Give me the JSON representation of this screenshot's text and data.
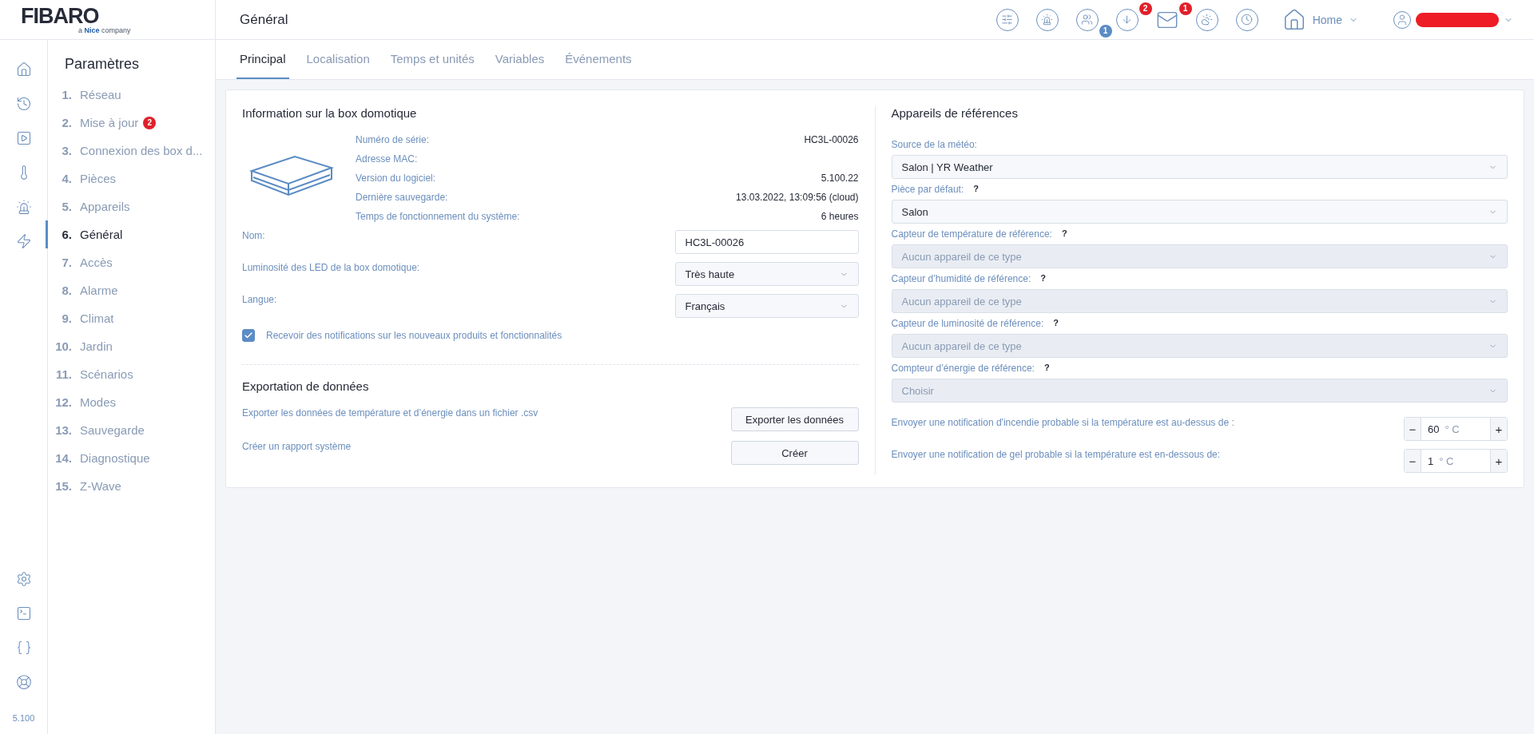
{
  "logo": {
    "name": "FIBARO",
    "tagline": "a **Nice** company"
  },
  "header": {
    "title": "Général",
    "icons": [
      {
        "kind": "devices"
      },
      {
        "kind": "alarm"
      },
      {
        "kind": "users",
        "badge": "1",
        "color": "#5b8cc4"
      },
      {
        "kind": "download",
        "badge": "2",
        "color": "#e0202a"
      },
      {
        "kind": "mail",
        "badge": "1",
        "color": "#e0202a"
      },
      {
        "kind": "weather"
      },
      {
        "kind": "clock"
      }
    ],
    "home": {
      "label": "Home"
    }
  },
  "rail": {
    "top": [
      {
        "kind": "home"
      },
      {
        "kind": "history"
      },
      {
        "kind": "scenes"
      },
      {
        "kind": "climate"
      },
      {
        "kind": "alarm"
      },
      {
        "kind": "energy"
      }
    ],
    "bottom": [
      {
        "kind": "settings"
      },
      {
        "kind": "terminal"
      },
      {
        "kind": "api"
      },
      {
        "kind": "help"
      }
    ],
    "version": "5.100"
  },
  "settings_menu": {
    "title": "Paramètres",
    "items": [
      {
        "number": "1.",
        "label": "Réseau",
        "selected": false
      },
      {
        "number": "2.",
        "label": "Mise à jour",
        "badge": "2",
        "selected": false
      },
      {
        "number": "3.",
        "label": "Connexion des box d...",
        "selected": false
      },
      {
        "number": "4.",
        "label": "Pièces",
        "selected": false
      },
      {
        "number": "5.",
        "label": "Appareils",
        "selected": false
      },
      {
        "number": "6.",
        "label": "Général",
        "selected": true
      },
      {
        "number": "7.",
        "label": "Accès",
        "selected": false
      },
      {
        "number": "8.",
        "label": "Alarme",
        "selected": false
      },
      {
        "number": "9.",
        "label": "Climat",
        "selected": false
      },
      {
        "number": "10.",
        "label": "Jardin",
        "selected": false
      },
      {
        "number": "11.",
        "label": "Scénarios",
        "selected": false
      },
      {
        "number": "12.",
        "label": "Modes",
        "selected": false
      },
      {
        "number": "13.",
        "label": "Sauvegarde",
        "selected": false
      },
      {
        "number": "14.",
        "label": "Diagnostique",
        "selected": false
      },
      {
        "number": "15.",
        "label": "Z-Wave",
        "selected": false
      }
    ]
  },
  "tabs": [
    {
      "label": "Principal",
      "selected": true
    },
    {
      "label": "Localisation",
      "selected": false
    },
    {
      "label": "Temps et unités",
      "selected": false
    },
    {
      "label": "Variables",
      "selected": false
    },
    {
      "label": "Événements",
      "selected": false
    }
  ],
  "box_info": {
    "title": "Information sur la box domotique",
    "rows": [
      {
        "label": "Numéro de série:",
        "value": "HC3L-00026"
      },
      {
        "label": "Adresse MAC:"
      },
      {
        "label": "Version du logiciel:",
        "value": "5.100.22"
      },
      {
        "label": "Dernière sauvegarde:",
        "value": "13.03.2022, 13:09:56 (cloud)"
      },
      {
        "label": "Temps de fonctionnement du système:",
        "value": "6 heures"
      }
    ],
    "fields": [
      {
        "kind": "input",
        "label": "Nom:",
        "value": "HC3L-00026"
      },
      {
        "kind": "select",
        "label": "Luminosité des LED de la box domotique:",
        "value": "Très haute"
      },
      {
        "kind": "select",
        "label": "Langue:",
        "value": "Français"
      }
    ],
    "checkbox": {
      "label": "Recevoir des notifications sur les nouveaux produits et fonctionnalités",
      "checked": true
    }
  },
  "export": {
    "title": "Exportation de données",
    "rows": [
      {
        "label": "Exporter les données de température et d’énergie dans un fichier .csv",
        "button": "Exporter les données"
      },
      {
        "label": "Créer un rapport système",
        "button": "Créer"
      }
    ]
  },
  "references": {
    "title": "Appareils de références",
    "selects": [
      {
        "label": "Source de la météo:",
        "value": "Salon | YR Weather",
        "disabled": false
      },
      {
        "label": "Pièce par défaut:",
        "help": "?",
        "value": "Salon",
        "disabled": false
      },
      {
        "label": "Capteur de température de référence:",
        "help": "?",
        "value": "Aucun appareil de ce type",
        "disabled": true
      },
      {
        "label": "Capteur d’humidité de référence:",
        "help": "?",
        "value": "Aucun appareil de ce type",
        "disabled": true
      },
      {
        "label": "Capteur de luminosité de référence:",
        "help": "?",
        "value": "Aucun appareil de ce type",
        "disabled": true
      },
      {
        "label": "Compteur d’énergie de référence:",
        "help": "?",
        "value": "Choisir",
        "disabled": true
      }
    ],
    "steppers": [
      {
        "label": "Envoyer une notification d'incendie probable si la température est au-dessus de :",
        "minus": "−",
        "value": "60",
        "unit": "° C",
        "plus": "+"
      },
      {
        "label": "Envoyer une notification de gel probable si la température est en-dessous de:",
        "minus": "−",
        "value": "1",
        "unit": "° C",
        "plus": "+"
      }
    ]
  }
}
